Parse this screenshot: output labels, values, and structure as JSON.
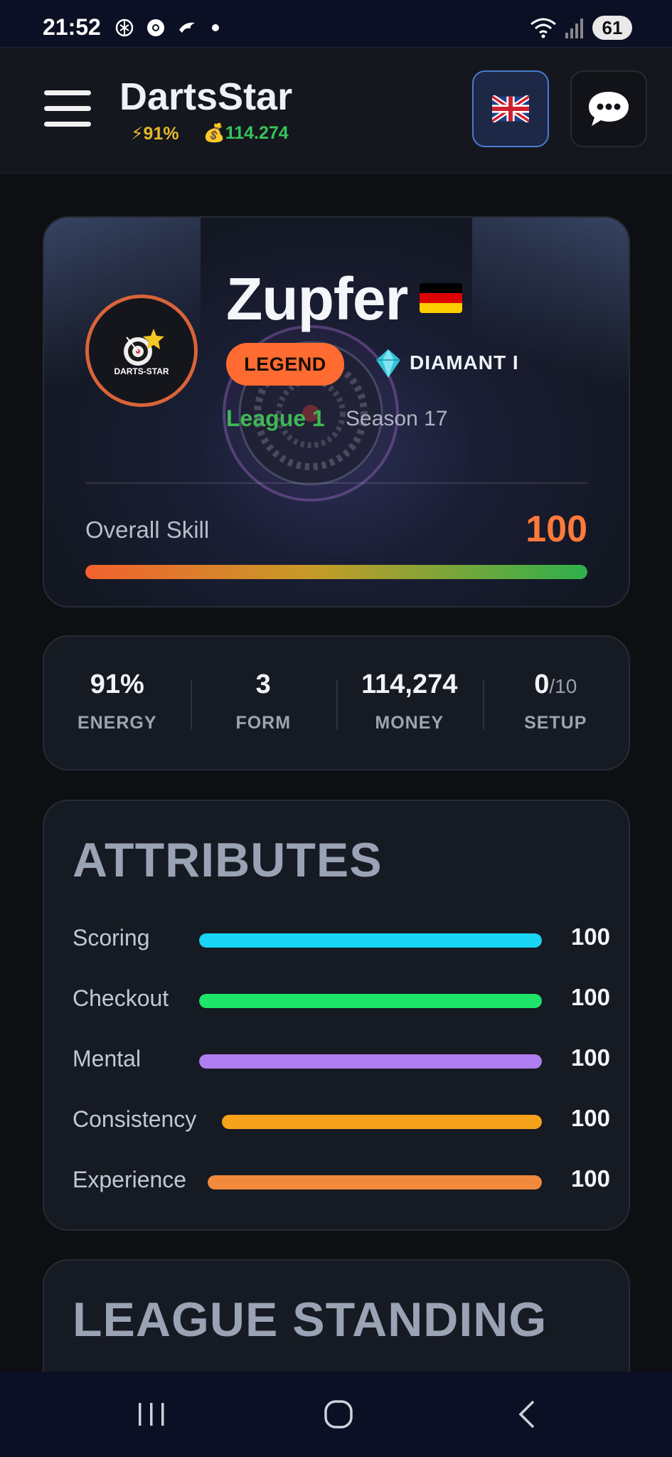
{
  "status_bar": {
    "time": "21:52",
    "battery": "61",
    "left_icons": [
      "openai-icon",
      "chrome-icon",
      "bird-icon",
      "notification-dot"
    ],
    "right_icons": [
      "wifi-icon",
      "signal-icon",
      "battery-icon"
    ]
  },
  "header": {
    "app_name": "DartsStar",
    "energy": "⚡91%",
    "money": "💰114.274",
    "language_flag": "uk-flag-icon",
    "chat_icon": "chat-bubble-icon"
  },
  "profile": {
    "name": "Zupfer",
    "country_flag": "germany-flag-icon",
    "avatar_text": "DARTS-STAR",
    "badge": "LEGEND",
    "rank": "DIAMANT I",
    "league": "League 1",
    "season": "Season 17",
    "overall_skill_label": "Overall Skill",
    "overall_skill_value": "100",
    "overall_skill_fraction": 1.0
  },
  "stats": [
    {
      "value": "91%",
      "suffix": "",
      "label": "ENERGY"
    },
    {
      "value": "3",
      "suffix": "",
      "label": "FORM"
    },
    {
      "value": "114,274",
      "suffix": "",
      "label": "MONEY"
    },
    {
      "value": "0",
      "suffix": "/10",
      "label": "SETUP"
    }
  ],
  "attributes": {
    "title": "ATTRIBUTES",
    "items": [
      {
        "name": "Scoring",
        "value": "100",
        "color": "#19d4f2",
        "fraction": 1.0
      },
      {
        "name": "Checkout",
        "value": "100",
        "color": "#1ee46a",
        "fraction": 1.0
      },
      {
        "name": "Mental",
        "value": "100",
        "color": "#b07ef0",
        "fraction": 1.0
      },
      {
        "name": "Consistency",
        "value": "100",
        "color": "#f6a21a",
        "fraction": 1.0
      },
      {
        "name": "Experience",
        "value": "100",
        "color": "#f28a3d",
        "fraction": 1.0
      }
    ]
  },
  "league_standing": {
    "title": "LEAGUE STANDING"
  },
  "colors": {
    "accent_orange": "#ff6b30",
    "league_green": "#3fb755",
    "energy_yellow": "#e6b82c",
    "money_green": "#36c45a"
  },
  "nav": {
    "recent_icon": "recent-apps-icon",
    "home_icon": "home-icon",
    "back_icon": "back-icon"
  }
}
